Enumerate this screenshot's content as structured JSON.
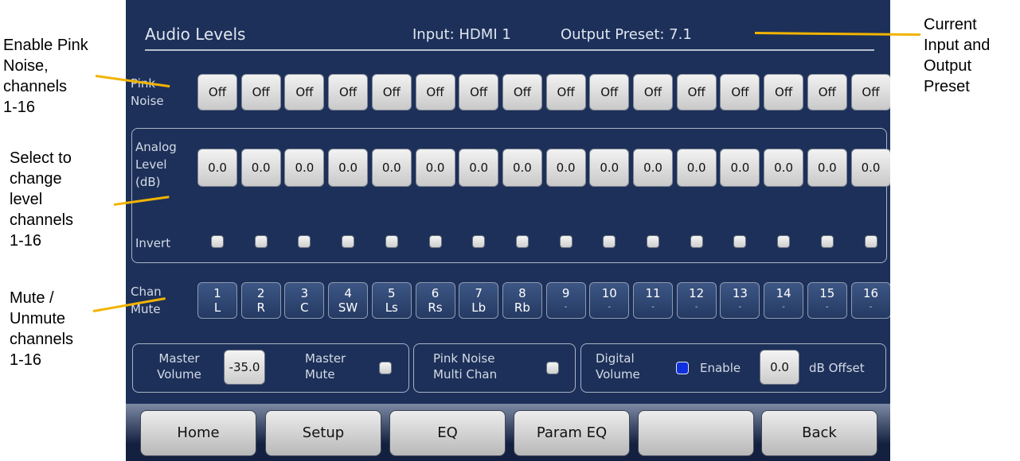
{
  "annotations": [
    {
      "id": "pink",
      "text": "Enable Pink\nNoise,\nchannels\n1-16"
    },
    {
      "id": "level",
      "text": "Select to\nchange\nlevel\nchannels\n1-16"
    },
    {
      "id": "mute",
      "text": "Mute /\nUnmute\nchannels\n1-16"
    },
    {
      "id": "preset",
      "text": "Current\nInput and\nOutput\nPreset"
    }
  ],
  "colors": {
    "screen_bg": "#1d3059",
    "pointer": "#f2b400",
    "footer": "#13203f"
  },
  "header": {
    "title": "Audio Levels",
    "input": "Input: HDMI 1",
    "output": "Output Preset:  7.1"
  },
  "labels": {
    "pink_noise": "Pink\nNoise",
    "analog_level": "Analog\nLevel\n(dB)",
    "invert": "Invert",
    "chan_mute": "Chan\nMute"
  },
  "pink_noise": [
    "Off",
    "Off",
    "Off",
    "Off",
    "Off",
    "Off",
    "Off",
    "Off",
    "Off",
    "Off",
    "Off",
    "Off",
    "Off",
    "Off",
    "Off",
    "Off"
  ],
  "analog_levels": [
    "0.0",
    "0.0",
    "0.0",
    "0.0",
    "0.0",
    "0.0",
    "0.0",
    "0.0",
    "0.0",
    "0.0",
    "0.0",
    "0.0",
    "0.0",
    "0.0",
    "0.0",
    "0.0"
  ],
  "invert": [
    false,
    false,
    false,
    false,
    false,
    false,
    false,
    false,
    false,
    false,
    false,
    false,
    false,
    false,
    false,
    false
  ],
  "channels": [
    {
      "num": "1",
      "name": "L"
    },
    {
      "num": "2",
      "name": "R"
    },
    {
      "num": "3",
      "name": "C"
    },
    {
      "num": "4",
      "name": "SW"
    },
    {
      "num": "5",
      "name": "Ls"
    },
    {
      "num": "6",
      "name": "Rs"
    },
    {
      "num": "7",
      "name": "Lb"
    },
    {
      "num": "8",
      "name": "Rb"
    },
    {
      "num": "9",
      "name": "-"
    },
    {
      "num": "10",
      "name": "-"
    },
    {
      "num": "11",
      "name": "-"
    },
    {
      "num": "12",
      "name": "-"
    },
    {
      "num": "13",
      "name": "-"
    },
    {
      "num": "14",
      "name": "-"
    },
    {
      "num": "15",
      "name": "-"
    },
    {
      "num": "16",
      "name": "-"
    }
  ],
  "bottom": {
    "master_volume_label": "Master\nVolume",
    "master_volume_value": "-35.0",
    "master_mute_label": "Master\nMute",
    "master_mute_checked": false,
    "pink_multi_label": "Pink Noise\nMulti Chan",
    "pink_multi_checked": false,
    "digital_volume_label": "Digital\nVolume",
    "digital_enable_label": "Enable",
    "digital_enable_checked": true,
    "digital_offset_value": "0.0",
    "digital_offset_label": "dB Offset"
  },
  "nav": [
    "Home",
    "Setup",
    "EQ",
    "Param EQ",
    "",
    "Back"
  ]
}
